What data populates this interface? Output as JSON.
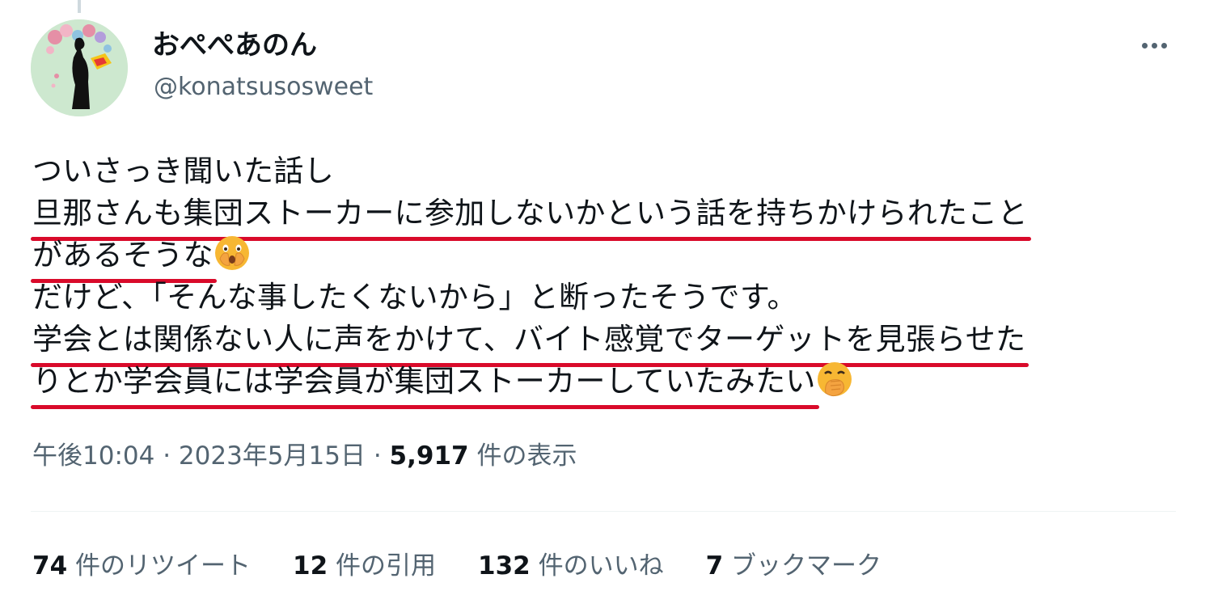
{
  "author": {
    "display_name": "おぺぺあのん",
    "handle": "@konatsusosweet",
    "avatar": "avatar-silhouette-kimono"
  },
  "tweet": {
    "lines": [
      {
        "parts": [
          {
            "text": "ついさっき聞いた話し",
            "underline": false
          }
        ]
      },
      {
        "parts": [
          {
            "text": "旦那さんも集団ストーカーに参加しないかという話を持ちかけられたこと",
            "underline": true
          }
        ]
      },
      {
        "parts": [
          {
            "text": "があるそうな",
            "underline": true
          }
        ],
        "emoji": "face-with-open-eyes-and-hand-over-mouth"
      },
      {
        "parts": [
          {
            "text": "だけど、「そんな事したくないから」と断ったそうです。",
            "underline": false
          }
        ]
      },
      {
        "parts": [
          {
            "text": "学会とは関係ない人に声をかけて、バイト感覚でターゲットを見張らせた",
            "underline": true
          }
        ]
      },
      {
        "parts": [
          {
            "text": "りとか学会員には学会員が集団ストーカーしていたみたい",
            "underline": true
          }
        ],
        "emoji": "face-with-hand-over-mouth"
      }
    ]
  },
  "meta": {
    "time": "午後10:04",
    "sep1": " · ",
    "date": "2023年5月15日",
    "sep2": " · ",
    "views_count": "5,917",
    "views_label": " 件の表示"
  },
  "stats": {
    "retweets": {
      "count": "74",
      "label": " 件のリツイート"
    },
    "quotes": {
      "count": "12",
      "label": " 件の引用"
    },
    "likes": {
      "count": "132",
      "label": " 件のいいね"
    },
    "bookmarks": {
      "count": "7",
      "label": " ブックマーク"
    }
  },
  "icons": {
    "more": "more-horizontal-icon"
  },
  "colors": {
    "underline": "#d90a2a",
    "secondary_text": "#536471",
    "primary_text": "#0f1419"
  }
}
